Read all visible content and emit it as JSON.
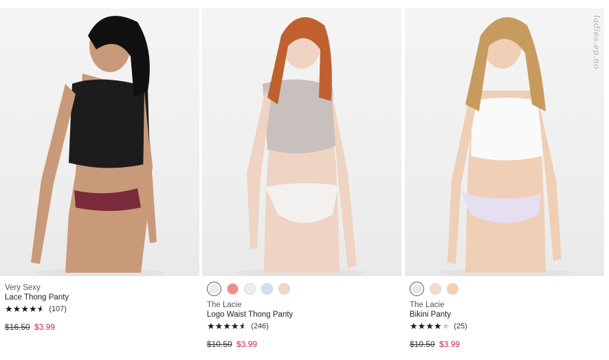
{
  "watermark": "ladies.ep.no",
  "colors": {
    "sale": "#c4245d",
    "star": "#1a1a1a"
  },
  "products": [
    {
      "collection": "Very Sexy",
      "name": "Lace Thong Panty",
      "rating": 4.5,
      "reviews": "(107)",
      "old_price": "$16.50",
      "sale_price": "$3.99",
      "swatches": []
    },
    {
      "collection": "The Lacie",
      "name": "Logo Waist Thong Panty",
      "rating": 4.5,
      "reviews": "(246)",
      "old_price": "$10.50",
      "sale_price": "$3.99",
      "swatches": [
        "#ececec",
        "#f28a8a",
        "#e9eef2",
        "#cfe0ea",
        "#f6d3c2"
      ]
    },
    {
      "collection": "The Lacie",
      "name": "Bikini Panty",
      "rating": 4,
      "reviews": "(25)",
      "old_price": "$10.50",
      "sale_price": "$3.99",
      "swatches": [
        "#e6e6e6",
        "#f7d9c6",
        "#f6d0b0"
      ]
    }
  ]
}
